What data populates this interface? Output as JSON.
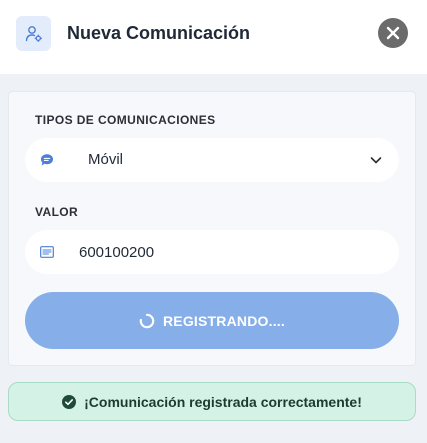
{
  "header": {
    "title": "Nueva Comunicación",
    "icon": "user-settings-icon",
    "close_icon": "close-icon"
  },
  "form": {
    "type_label": "TIPOS DE COMUNICACIONES",
    "type_value": "Móvil",
    "type_icon": "chat-bubble-icon",
    "value_label": "VALOR",
    "value_text": "600100200",
    "value_icon": "text-lines-icon",
    "submit_label": "REGISTRANDO....",
    "submit_state": "loading"
  },
  "toast": {
    "message": "¡Comunicación registrada correctamente!",
    "status": "success"
  },
  "colors": {
    "accent": "#86aee8",
    "success_bg": "#d5f2e6",
    "success_icon": "#1f4b3a",
    "icon_blue": "#4b7fd9"
  }
}
